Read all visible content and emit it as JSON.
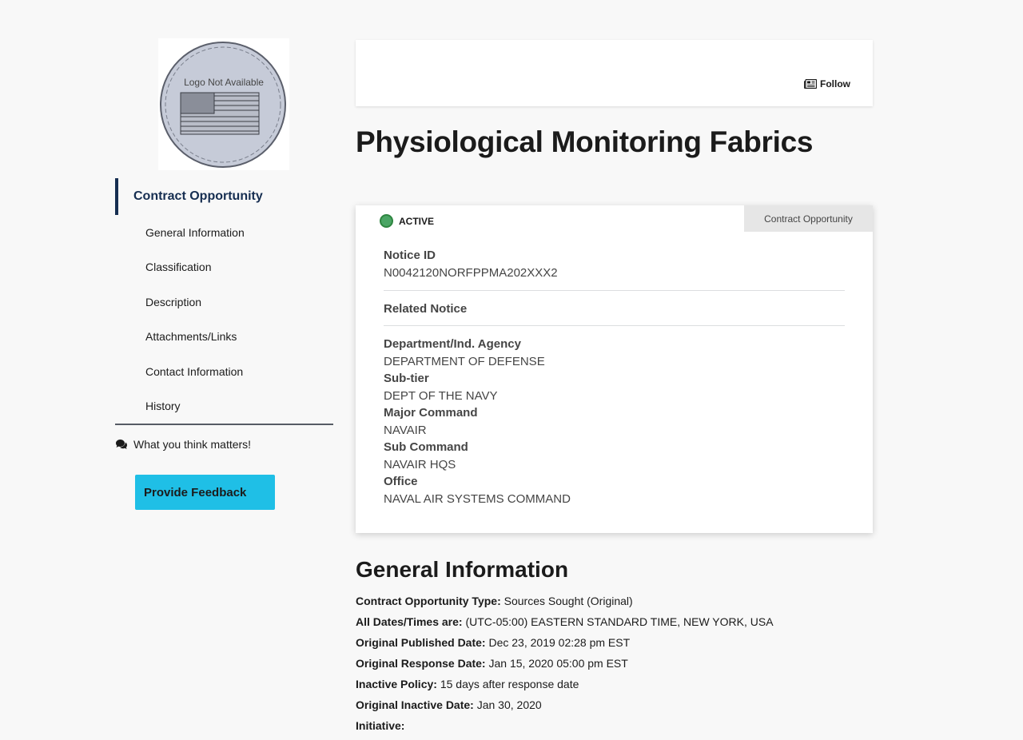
{
  "logo": {
    "caption": "Logo Not Available"
  },
  "sidebar": {
    "heading": "Contract Opportunity",
    "items": [
      {
        "label": "General Information"
      },
      {
        "label": "Classification"
      },
      {
        "label": "Description"
      },
      {
        "label": "Attachments/Links"
      },
      {
        "label": "Contact Information"
      },
      {
        "label": "History"
      }
    ],
    "feedback_text": "What you think matters!",
    "feedback_button": "Provide Feedback"
  },
  "header": {
    "follow_label": "Follow",
    "follow_icon": "newspaper-icon"
  },
  "page_title": "Physiological Monitoring Fabrics",
  "notice": {
    "status": "ACTIVE",
    "status_color": "#4aa564",
    "type_tag": "Contract Opportunity",
    "notice_id_label": "Notice ID",
    "notice_id": "N0042120NORFPPMA202XXX2",
    "related_label": "Related Notice",
    "fields": [
      {
        "label": "Department/Ind. Agency",
        "value": "DEPARTMENT OF DEFENSE"
      },
      {
        "label": "Sub-tier",
        "value": "DEPT OF THE NAVY"
      },
      {
        "label": "Major Command",
        "value": "NAVAIR"
      },
      {
        "label": "Sub Command",
        "value": "NAVAIR HQS"
      },
      {
        "label": "Office",
        "value": "NAVAL AIR SYSTEMS COMMAND"
      }
    ]
  },
  "general_info": {
    "heading": "General Information",
    "rows": [
      {
        "key": "Contract Opportunity Type:",
        "value": " Sources Sought (Original)"
      },
      {
        "key": "All Dates/Times are:",
        "value": " (UTC-05:00) EASTERN STANDARD TIME, NEW YORK, USA"
      },
      {
        "key": "Original Published Date:",
        "value": " Dec 23, 2019 02:28 pm EST"
      },
      {
        "key": "Original Response Date:",
        "value": " Jan 15, 2020 05:00 pm EST"
      },
      {
        "key": "Inactive Policy:",
        "value": " 15 days after response date"
      },
      {
        "key": "Original Inactive Date:",
        "value": " Jan 30, 2020"
      },
      {
        "key": "Initiative:",
        "value": ""
      }
    ]
  },
  "colors": {
    "nav_accent": "#162e51",
    "feedback_button": "#1fbfe6"
  }
}
